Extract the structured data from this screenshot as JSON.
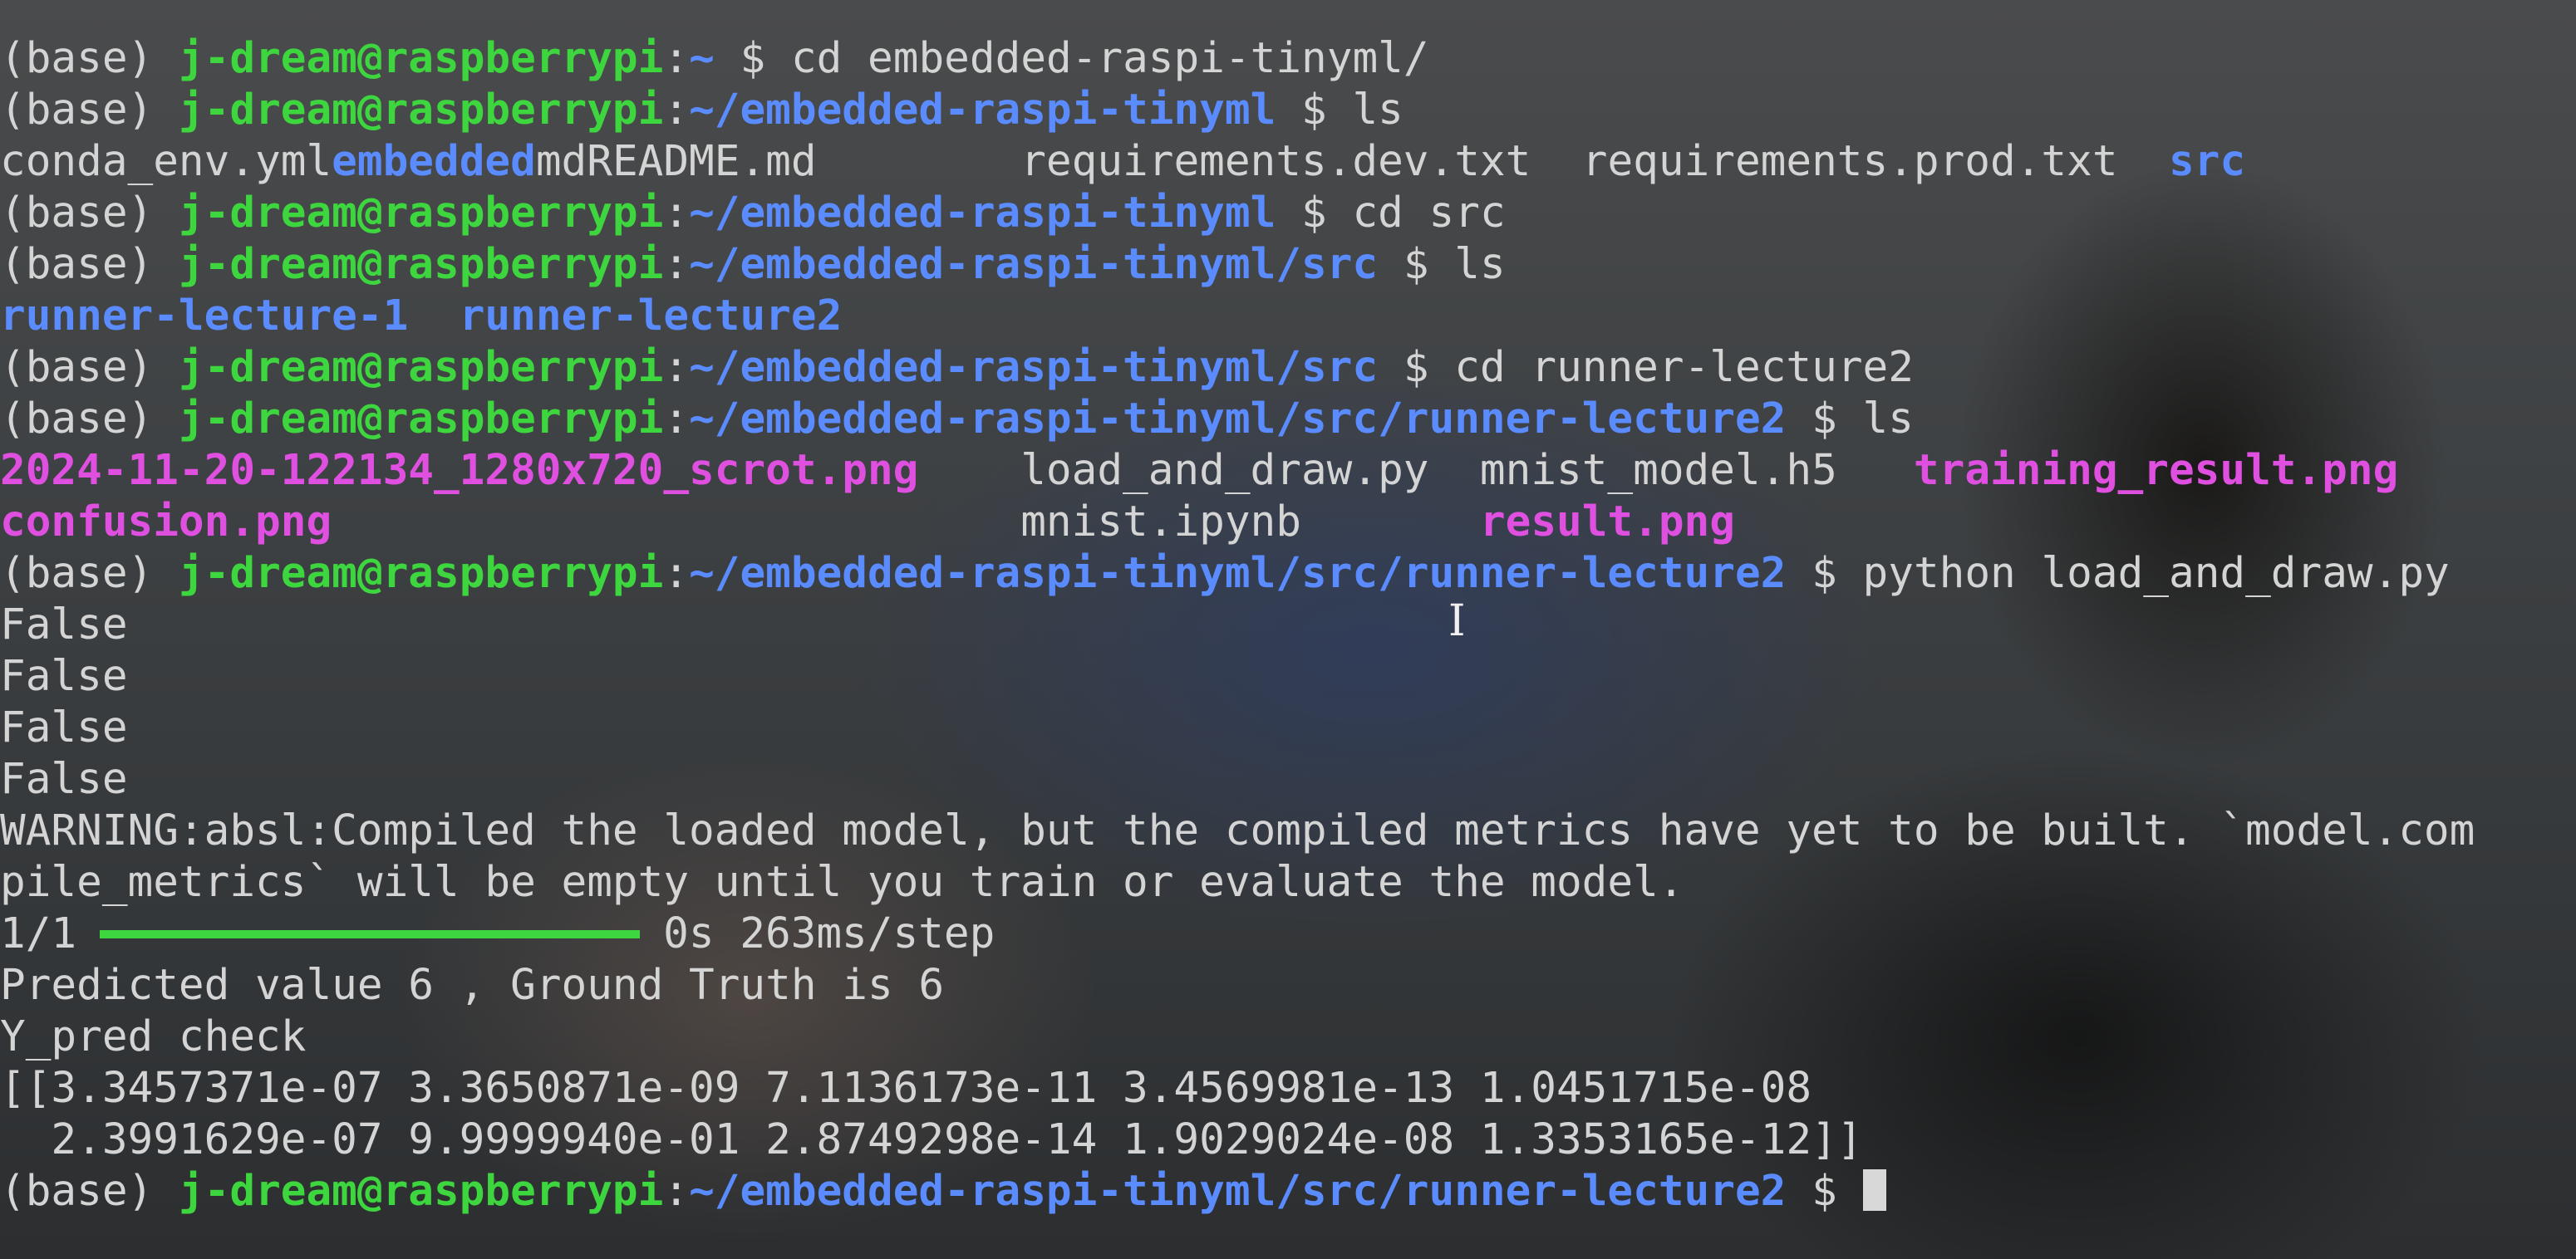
{
  "prompt": {
    "env": "(base)",
    "user_host": "j-dream@raspberrypi",
    "colon": ":",
    "dollar": "$"
  },
  "lines": [
    {
      "type": "cmd",
      "path": "~",
      "command": "cd embedded-raspi-tinyml/"
    },
    {
      "type": "cmd",
      "path": "~/embedded-raspi-tinyml",
      "command": "ls"
    },
    {
      "type": "listing",
      "items": [
        {
          "text": "conda_env.yml",
          "kind": "file"
        },
        {
          "text": "embedded",
          "kind": "dir"
        },
        {
          "text": "md",
          "kind": "file"
        },
        {
          "text": "README.md",
          "kind": "file"
        },
        {
          "text": "requirements.dev.txt",
          "kind": "file"
        },
        {
          "text": "requirements.prod.txt",
          "kind": "file"
        },
        {
          "text": "src",
          "kind": "dir"
        }
      ]
    },
    {
      "type": "cmd",
      "path": "~/embedded-raspi-tinyml",
      "command": "cd src"
    },
    {
      "type": "cmd",
      "path": "~/embedded-raspi-tinyml/src",
      "command": "ls"
    },
    {
      "type": "listing",
      "items": [
        {
          "text": "runner-lecture-1",
          "kind": "dir"
        },
        {
          "text": "runner-lecture2",
          "kind": "dir"
        }
      ]
    },
    {
      "type": "cmd",
      "path": "~/embedded-raspi-tinyml/src",
      "command": "cd runner-lecture2"
    },
    {
      "type": "cmd",
      "path": "~/embedded-raspi-tinyml/src/runner-lecture2",
      "command": "ls"
    },
    {
      "type": "listing",
      "items": [
        {
          "text": "2024-11-20-122134_1280x720_scrot.png",
          "kind": "image"
        },
        {
          "text": "load_and_draw.py",
          "kind": "file"
        },
        {
          "text": "mnist_model.h5",
          "kind": "file"
        },
        {
          "text": "training_result.png",
          "kind": "image"
        }
      ]
    },
    {
      "type": "listing",
      "items": [
        {
          "text": "confusion.png",
          "kind": "image"
        },
        {
          "text": "mnist.ipynb",
          "kind": "file"
        },
        {
          "text": "result.png",
          "kind": "image"
        }
      ]
    },
    {
      "type": "cmd",
      "path": "~/embedded-raspi-tinyml/src/runner-lecture2",
      "command": "python load_and_draw.py"
    },
    {
      "type": "output",
      "text": "False"
    },
    {
      "type": "output",
      "text": "False"
    },
    {
      "type": "output",
      "text": "False"
    },
    {
      "type": "output",
      "text": "False"
    },
    {
      "type": "output",
      "text": "WARNING:absl:Compiled the loaded model, but the compiled metrics have yet to be built. `model.com"
    },
    {
      "type": "output",
      "text": "pile_metrics` will be empty until you train or evaluate the model."
    },
    {
      "type": "progress",
      "step": "1/1",
      "fraction": 1.0,
      "timing": "0s 263ms/step"
    },
    {
      "type": "output",
      "text": "Predicted value 6 , Ground Truth is 6"
    },
    {
      "type": "output",
      "text": "Y_pred check"
    },
    {
      "type": "output",
      "text": "[[3.3457371e-07 3.3650871e-09 7.1136173e-11 3.4569981e-13 1.0451715e-08"
    },
    {
      "type": "output",
      "text": "  2.3991629e-07 9.9999940e-01 2.8749298e-14 1.9029024e-08 1.3353165e-12]]"
    },
    {
      "type": "cmd",
      "path": "~/embedded-raspi-tinyml/src/runner-lecture2",
      "command": "",
      "cursor": true
    }
  ],
  "colors": {
    "user_host": "#3ed63e",
    "path": "#5b8cff",
    "directory": "#5b8cff",
    "image_file": "#e050e0",
    "text": "#d4d4d4",
    "progress_bar": "#3ed63e"
  },
  "icons": {
    "mouse_pointer": "text-cursor-ibeam-icon"
  }
}
